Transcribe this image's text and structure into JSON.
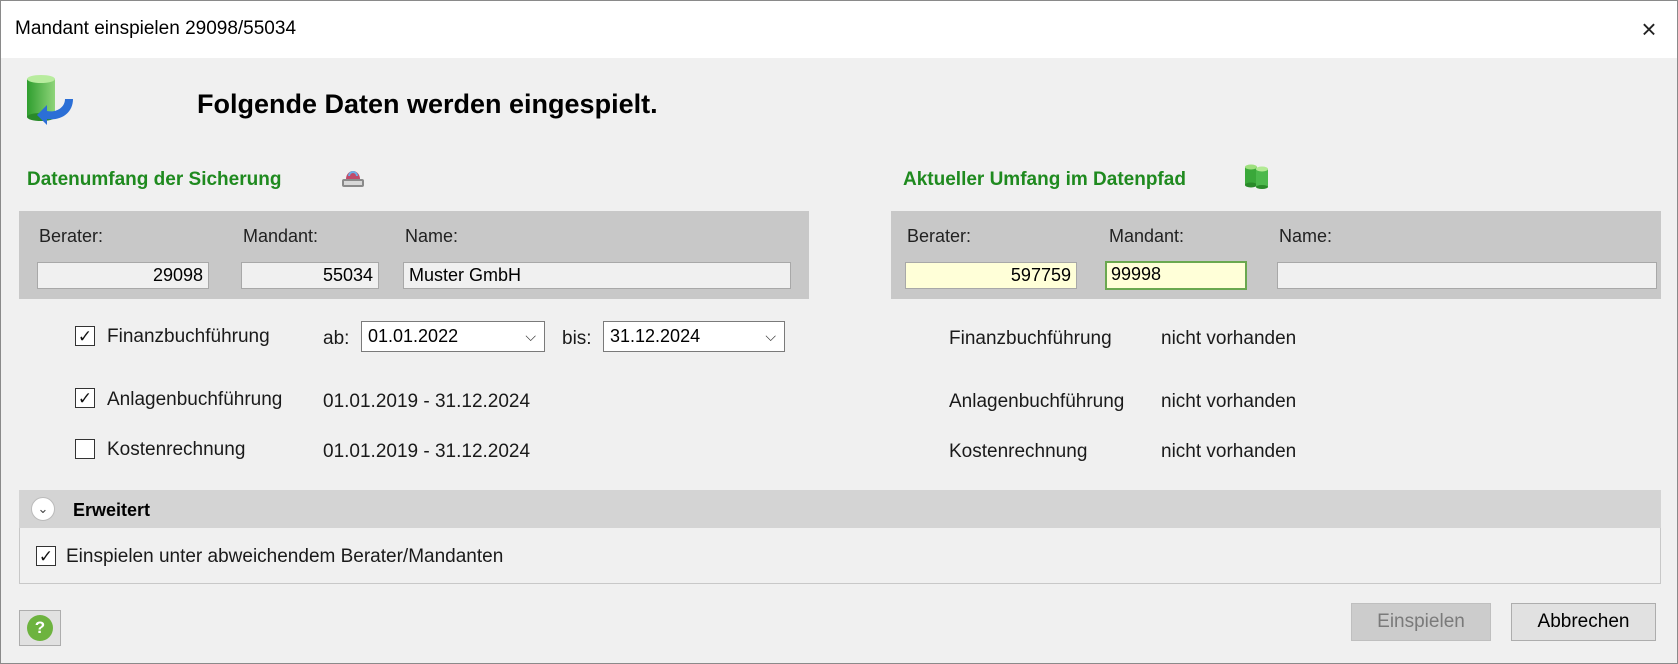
{
  "window": {
    "title": "Mandant einspielen 29098/55034",
    "close_icon": "×"
  },
  "heading": "Folgende Daten werden eingespielt.",
  "left": {
    "section_title": "Datenumfang der Sicherung",
    "berater_label": "Berater:",
    "mandant_label": "Mandant:",
    "name_label": "Name:",
    "berater_value": "29098",
    "mandant_value": "55034",
    "name_value": "Muster GmbH",
    "rows": [
      {
        "label": "Finanzbuchführung",
        "checked": true,
        "check_glyph": "✓"
      },
      {
        "label": "Anlagenbuchführung",
        "checked": true,
        "check_glyph": "✓",
        "range": "01.01.2019 - 31.12.2024"
      },
      {
        "label": "Kostenrechnung",
        "checked": false,
        "check_glyph": "",
        "range": "01.01.2019 - 31.12.2024"
      }
    ],
    "ab_label": "ab:",
    "ab_value": "01.01.2022",
    "bis_label": "bis:",
    "bis_value": "31.12.2024"
  },
  "right": {
    "section_title": "Aktueller Umfang im Datenpfad",
    "berater_label": "Berater:",
    "mandant_label": "Mandant:",
    "name_label": "Name:",
    "berater_value": "597759",
    "mandant_value": "99998",
    "name_value": "",
    "rows": [
      {
        "label": "Finanzbuchführung",
        "status": "nicht vorhanden"
      },
      {
        "label": "Anlagenbuchführung",
        "status": "nicht vorhanden"
      },
      {
        "label": "Kostenrechnung",
        "status": "nicht vorhanden"
      }
    ]
  },
  "advanced": {
    "title": "Erweitert",
    "chevron_glyph": "⌄",
    "option_label": "Einspielen unter abweichendem Berater/Mandanten",
    "option_checked": true,
    "check_glyph": "✓"
  },
  "buttons": {
    "help_glyph": "?",
    "import_label": "Einspielen",
    "cancel_label": "Abbrechen"
  },
  "colors": {
    "section_title": "#1f8a1f",
    "panel": "#c8c8c8",
    "highlight_field": "#ffffd8"
  },
  "combo_arrow": "⌵"
}
